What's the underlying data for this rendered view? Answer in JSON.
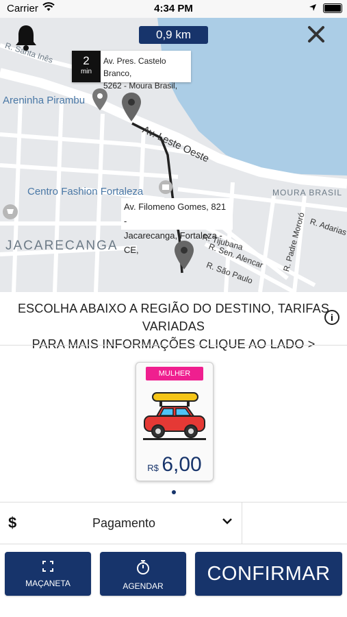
{
  "status_bar": {
    "carrier": "Carrier",
    "time": "4:34 PM"
  },
  "map": {
    "distance": "0,9 km",
    "eta": {
      "value": "2",
      "unit": "min",
      "address_line1": "Av. Pres. Castelo Branco,",
      "address_line2": "5262 - Moura Brasil,"
    },
    "destination": {
      "line1": "Av. Filomeno Gomes, 821 -",
      "line2": "Jacarecanga, Fortaleza - CE,"
    },
    "labels": {
      "santa_ines": "R. Santa Inês",
      "areninha": "Areninha Pirambu",
      "leste_oeste": "Av. Leste Oeste",
      "centro_fashion": "Centro Fashion Fortaleza",
      "moura_brasil": "MOURA BRASIL",
      "jacarecanga": "JACARECANGA",
      "tijubana": "R. Tijubana",
      "sen_alencar": "R. Sen. Alencar",
      "sao_paulo": "R. São Paulo",
      "padre_mororo": "R. Padre Mororó",
      "adarias": "R. Adarias"
    }
  },
  "notice": {
    "line1": "ESCOLHA ABAIXO A REGIÃO DO DESTINO, TARIFAS VARIADAS",
    "line2": "PARA MAIS INFORMAÇÕES CLIQUE AO LADO >"
  },
  "fare_card": {
    "tag": "MULHER",
    "currency": "R$",
    "price": "6,00"
  },
  "payment": {
    "symbol": "$",
    "label": "Pagamento"
  },
  "buttons": {
    "maçaneta": "MAÇANETA",
    "agendar": "AGENDAR",
    "confirmar": "CONFIRMAR"
  },
  "colors": {
    "primary": "#17346b",
    "tag": "#ef1f8f",
    "water": "#abcde6"
  }
}
